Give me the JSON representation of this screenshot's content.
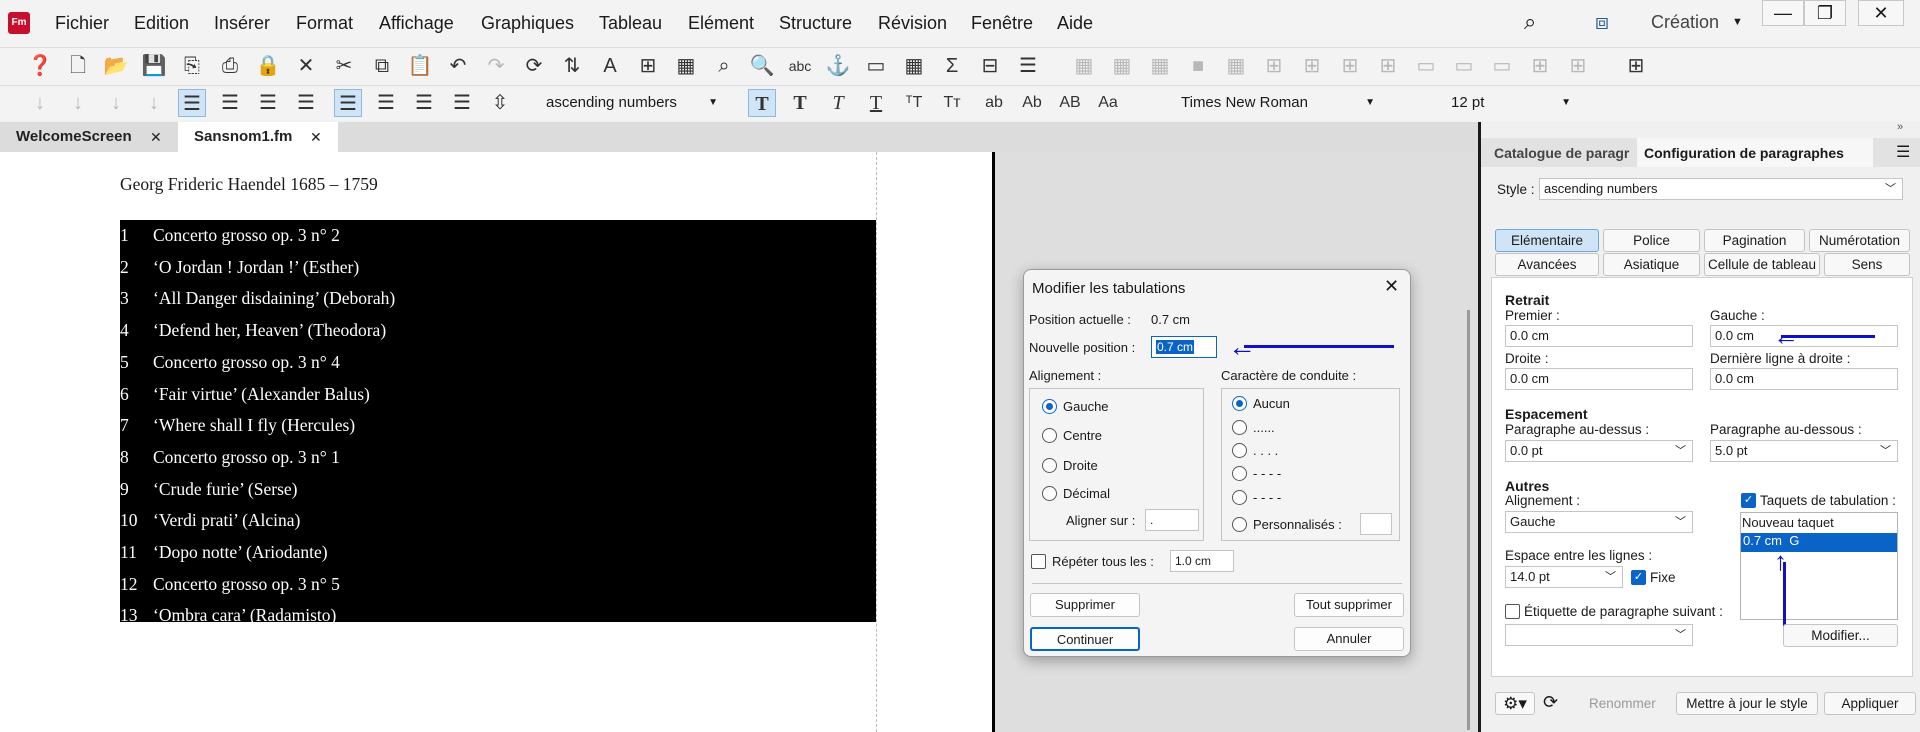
{
  "app": {
    "icon_text": "Fm",
    "menu": [
      "Fichier",
      "Edition",
      "Insérer",
      "Format",
      "Affichage",
      "Graphiques",
      "Tableau",
      "Elément",
      "Structure",
      "Révision",
      "Fenêtre",
      "Aide"
    ],
    "workspace": "Création",
    "window_buttons": [
      "—",
      "❐",
      "✕"
    ]
  },
  "toolbar2": {
    "para_format": "ascending numbers",
    "font": "Times New Roman",
    "size": "12 pt",
    "char_styles": [
      "ab",
      "Ab",
      "AB",
      "Aa"
    ]
  },
  "tabs": [
    {
      "label": "WelcomeScreen",
      "close": "✕"
    },
    {
      "label": "Sansnom1.fm",
      "close": "✕"
    }
  ],
  "document": {
    "title_line": "Georg Frideric Haendel 1685 – 1759",
    "items": [
      {
        "num": "1",
        "text": "Concerto grosso op. 3 n° 2"
      },
      {
        "num": "2",
        "text": "‘O Jordan ! Jordan !’ (Esther)"
      },
      {
        "num": "3",
        "text": "‘All Danger disdaining’ (Deborah)"
      },
      {
        "num": "4",
        "text": "‘Defend her, Heaven’ (Theodora)"
      },
      {
        "num": "5",
        "text": "Concerto grosso op. 3 n° 4"
      },
      {
        "num": "6",
        "text": "‘Fair virtue’ (Alexander Balus)"
      },
      {
        "num": "7",
        "text": "‘Where shall I fly (Hercules)"
      },
      {
        "num": "8",
        "text": "Concerto grosso op. 3 n° 1"
      },
      {
        "num": "9",
        "text": "‘Crude furie’ (Serse)"
      },
      {
        "num": "10",
        "text": "‘Verdi prati’ (Alcina)"
      },
      {
        "num": "11",
        "text": "‘Dopo notte’ (Ariodante)"
      },
      {
        "num": "12",
        "text": "Concerto grosso op. 3 n° 5"
      },
      {
        "num": "13",
        "text": "‘Ombra cara’ (Radamisto)"
      }
    ]
  },
  "dialog": {
    "title": "Modifier les tabulations",
    "close": "✕",
    "current_position_label": "Position actuelle :",
    "current_position_value": "0.7 cm",
    "new_position_label": "Nouvelle position :",
    "new_position_value": "0.7 cm",
    "alignment_label": "Alignement :",
    "alignment_options": [
      "Gauche",
      "Centre",
      "Droite",
      "Décimal"
    ],
    "align_on_label": "Aligner sur :",
    "align_on_value": ".",
    "leader_label": "Caractère de conduite :",
    "leader_options": [
      "Aucun",
      "......",
      ". . . .",
      "- - - -",
      "- - - -"
    ],
    "custom_label": "Personnalisés :",
    "repeat_label": "Répéter tous les :",
    "repeat_value": "1.0 cm",
    "btn_delete": "Supprimer",
    "btn_delete_all": "Tout supprimer",
    "btn_continue": "Continuer",
    "btn_cancel": "Annuler"
  },
  "panel": {
    "tab_catalog": "Catalogue de paragr",
    "tab_config": "Configuration de paragraphes",
    "style_label": "Style :",
    "style_value": "ascending numbers",
    "subtabs_row1": [
      "Elémentaire",
      "Police",
      "Pagination",
      "Numérotation"
    ],
    "subtabs_row2": [
      "Avancées",
      "Asiatique",
      "Cellule de tableau",
      "Sens"
    ],
    "retrait": "Retrait",
    "premier_label": "Premier :",
    "premier_value": "0.0 cm",
    "gauche_label": "Gauche :",
    "gauche_value": "0.0 cm",
    "droite_label": "Droite :",
    "droite_value": "0.0 cm",
    "derniere_label": "Dernière ligne à droite :",
    "derniere_value": "0.0 cm",
    "espacement": "Espacement",
    "above_label": "Paragraphe au-dessus :",
    "above_value": "0.0 pt",
    "below_label": "Paragraphe au-dessous :",
    "below_value": "5.0 pt",
    "autres": "Autres",
    "alignment_label": "Alignement :",
    "alignment_value": "Gauche",
    "tabstops_label": "Taquets de tabulation :",
    "tabstops": [
      "Nouveau taquet",
      "0.7 cm  G"
    ],
    "line_spacing_label": "Espace entre les lignes :",
    "line_spacing_value": "14.0 pt",
    "fixed_label": "Fixe",
    "next_tag_label": "Étiquette de paragraphe suivant :",
    "modify_btn": "Modifier...",
    "rename_btn": "Renommer",
    "update_btn": "Mettre à jour le style",
    "apply_btn": "Appliquer"
  },
  "colors": {
    "accent": "#0a64c8",
    "arrow": "#1010c8",
    "selection_bg": "#000000",
    "selected_item_bg": "#0a64c8"
  }
}
